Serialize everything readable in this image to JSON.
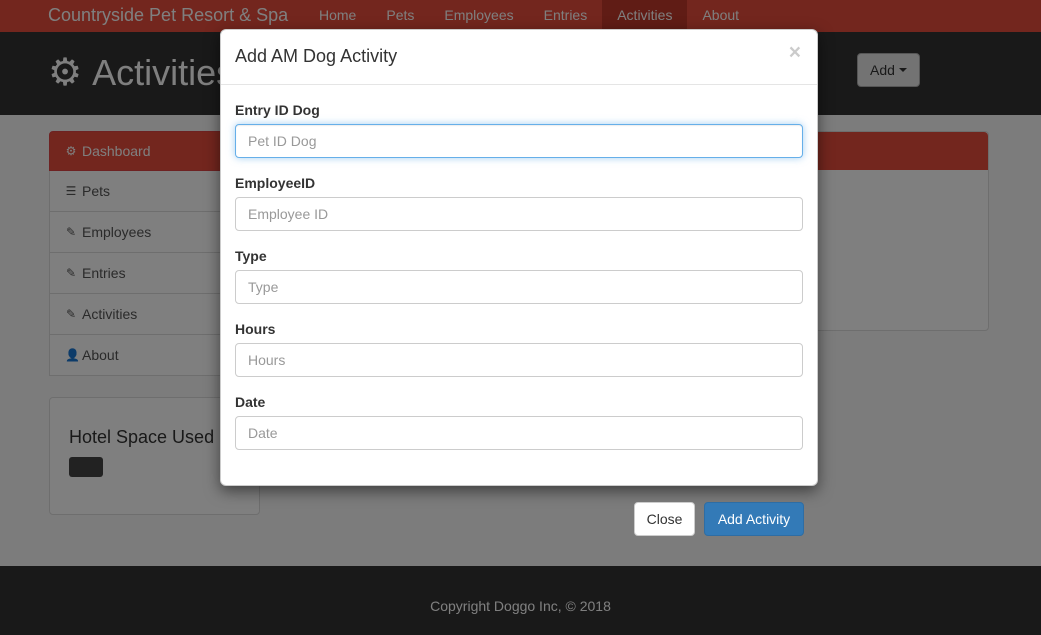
{
  "navbar": {
    "brand": "Countryside Pet Resort & Spa",
    "links": [
      "Home",
      "Pets",
      "Employees",
      "Entries",
      "Activities",
      "About"
    ],
    "active": "Activities"
  },
  "header": {
    "title": "Activities",
    "icon": "gear-icon",
    "add_label": "Add"
  },
  "sidebar": {
    "items": [
      {
        "label": "Dashboard",
        "icon": "gear-icon"
      },
      {
        "label": "Pets",
        "icon": "list-icon"
      },
      {
        "label": "Employees",
        "icon": "pencil-icon"
      },
      {
        "label": "Entries",
        "icon": "pencil-icon"
      },
      {
        "label": "Activities",
        "icon": "pencil-icon"
      },
      {
        "label": "About",
        "icon": "user-icon"
      }
    ]
  },
  "hotel": {
    "title": "Hotel Space Used"
  },
  "modal": {
    "title": "Add AM Dog Activity",
    "close_symbol": "×",
    "fields": [
      {
        "label": "Entry ID Dog",
        "placeholder": "Pet ID Dog",
        "value": ""
      },
      {
        "label": "EmployeeID",
        "placeholder": "Employee ID",
        "value": ""
      },
      {
        "label": "Type",
        "placeholder": "Type",
        "value": ""
      },
      {
        "label": "Hours",
        "placeholder": "Hours",
        "value": ""
      },
      {
        "label": "Date",
        "placeholder": "Date",
        "value": ""
      }
    ],
    "close_label": "Close",
    "submit_label": "Add Activity"
  },
  "footer": {
    "text": "Copyright Doggo Inc, © 2018"
  },
  "colors": {
    "accent": "#e74c3c",
    "accent_dark": "#c0392b",
    "header_bg": "#333333",
    "primary": "#337ab7"
  }
}
